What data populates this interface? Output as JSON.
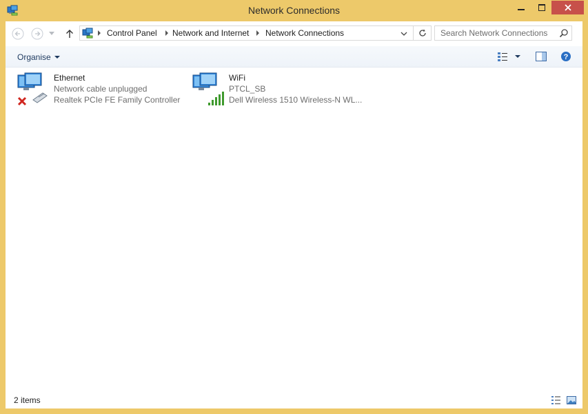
{
  "window": {
    "title": "Network Connections"
  },
  "address": {
    "crumbs": [
      "Control Panel",
      "Network and Internet",
      "Network Connections"
    ]
  },
  "search": {
    "placeholder": "Search Network Connections"
  },
  "toolbar": {
    "organise_label": "Organise"
  },
  "items": [
    {
      "name": "Ethernet",
      "status": "Network cable unplugged",
      "device": "Realtek PCIe FE Family Controller",
      "icon": "ethernet-adapter-icon",
      "state": "disconnected"
    },
    {
      "name": "WiFi",
      "status": "PTCL_SB",
      "device": "Dell Wireless 1510 Wireless-N WL...",
      "icon": "wifi-adapter-icon",
      "state": "connected"
    }
  ],
  "status": {
    "count": "2 items"
  },
  "colors": {
    "frame": "#edc96a",
    "close": "#c7504a",
    "accent": "#1e3a5f",
    "signal": "#3f9a2e",
    "error": "#d0261f"
  }
}
